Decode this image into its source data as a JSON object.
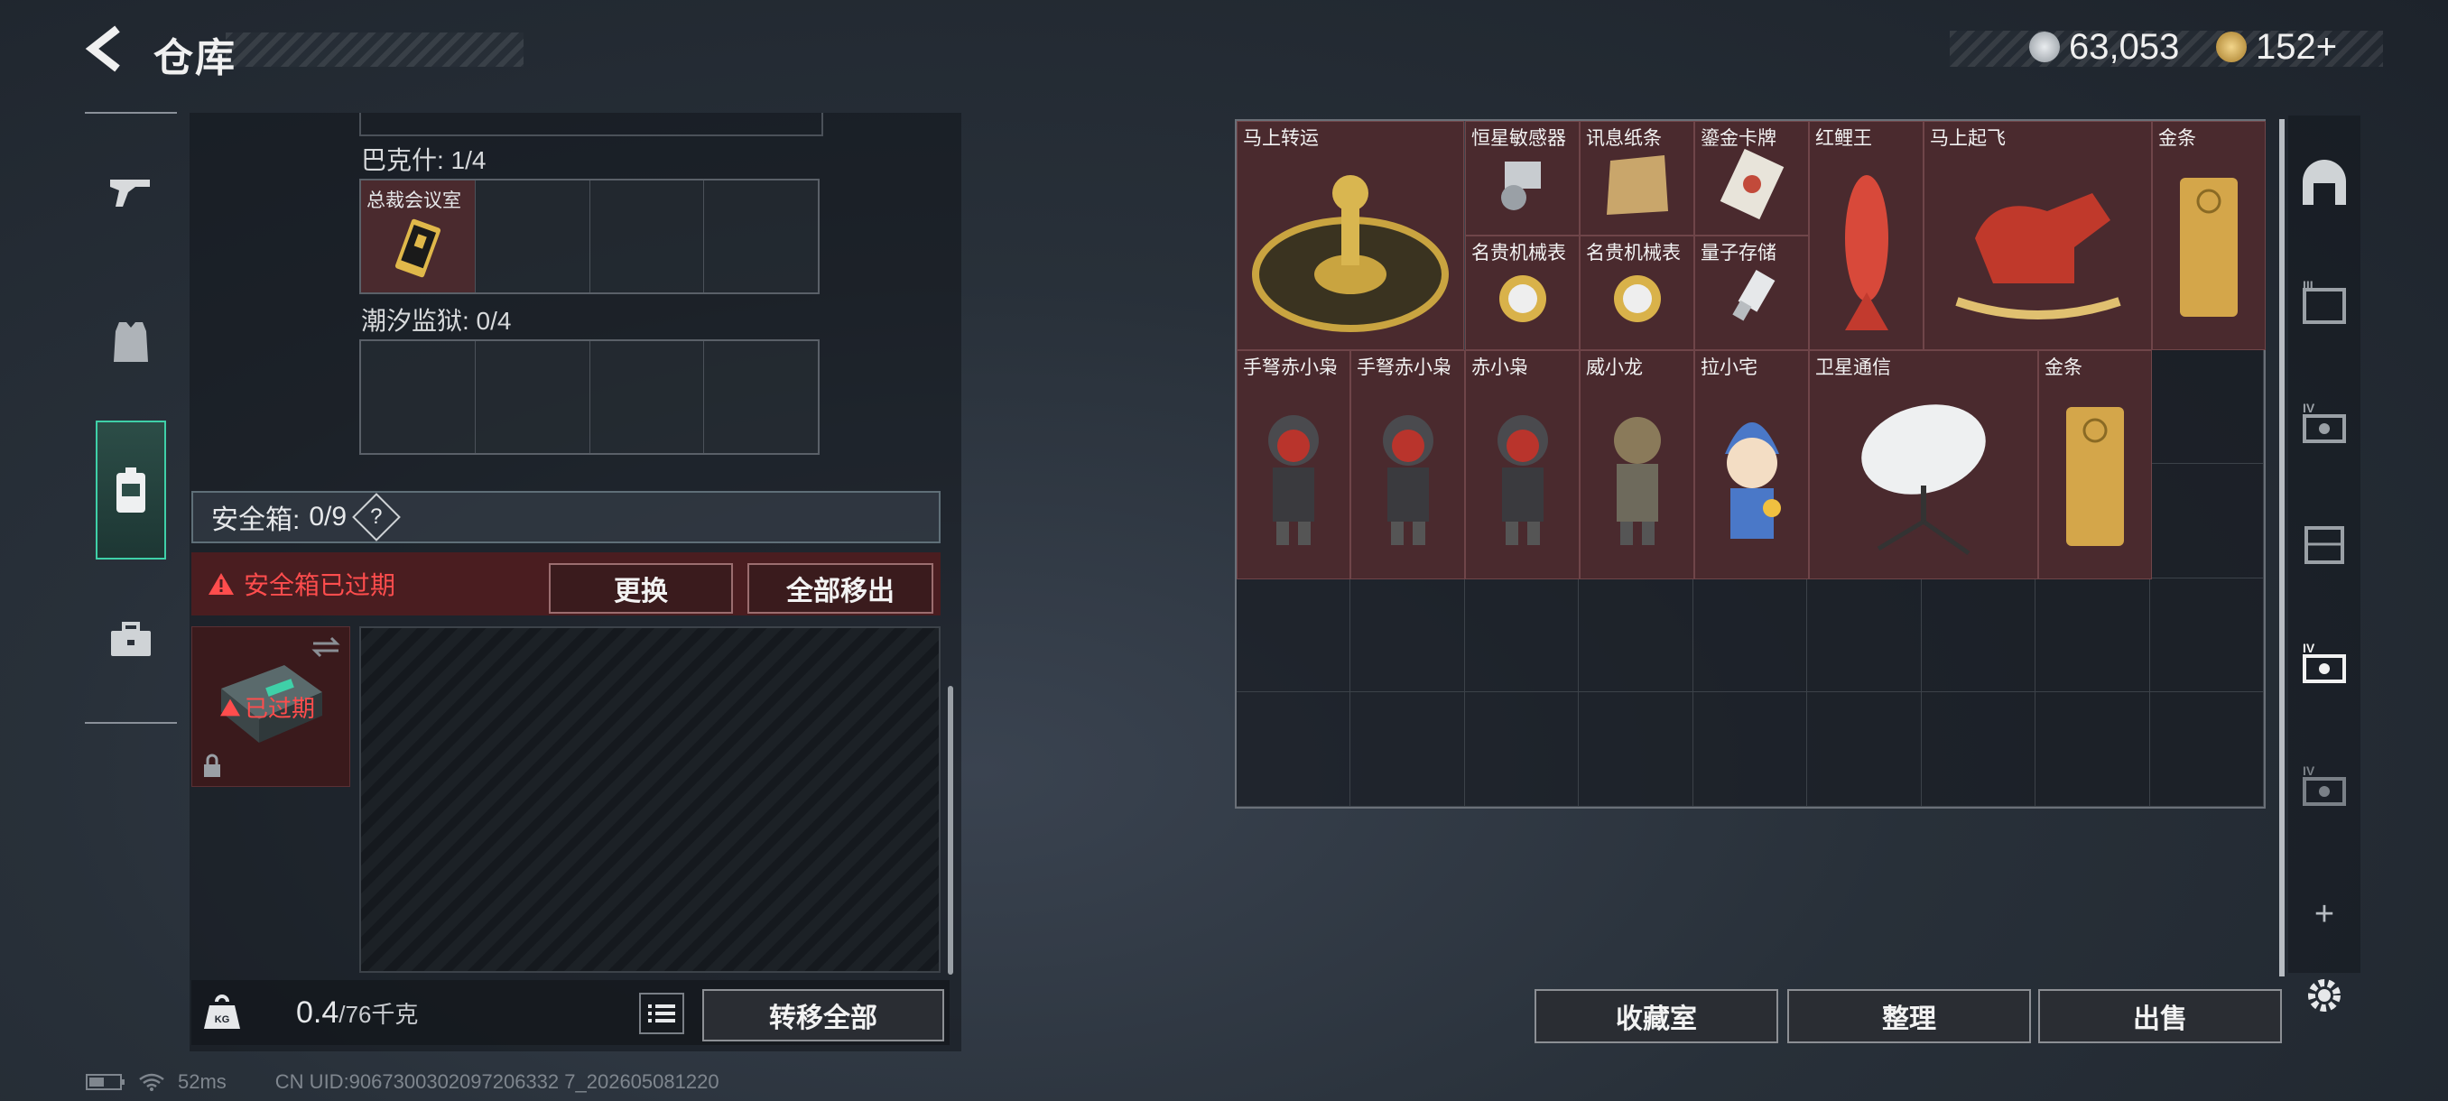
{
  "header": {
    "title": "仓库"
  },
  "currency": [
    {
      "value": "63,053",
      "icon": "silver-coin-icon",
      "color": "#c7ccd1"
    },
    {
      "value": "152+",
      "icon": "gold-coin-icon",
      "color": "#d9b45a"
    }
  ],
  "nav": [
    {
      "icon": "gun-icon"
    },
    {
      "icon": "armor-vest-icon"
    },
    {
      "icon": "backpack-icon",
      "active": true
    },
    {
      "icon": "briefcase-icon"
    }
  ],
  "containers": [
    {
      "label": "巴克什: 1/4",
      "items": [
        {
          "name": "总裁会议室",
          "icon": "keycard-icon"
        }
      ]
    },
    {
      "label": "潮汐监狱: 0/4",
      "items": []
    }
  ],
  "safebox": {
    "label": "安全箱:",
    "value": "0/9",
    "help": "?",
    "warning": "安全箱已过期",
    "replace_label": "更换",
    "remove_all_label": "全部移出",
    "expired_label": "已过期"
  },
  "weight": {
    "current": "0.4",
    "max": "/76千克",
    "transfer_all_label": "转移全部"
  },
  "stash_items": [
    {
      "name": "马上转运"
    },
    {
      "name": "恒星敏感器"
    },
    {
      "name": "讯息纸条"
    },
    {
      "name": "鎏金卡牌"
    },
    {
      "name": "红鲤王"
    },
    {
      "name": "马上起飞"
    },
    {
      "name": "金条"
    },
    {
      "name": "名贵机械表"
    },
    {
      "name": "名贵机械表"
    },
    {
      "name": "量子存储"
    },
    {
      "name": "手弩赤小枭"
    },
    {
      "name": "手弩赤小枭"
    },
    {
      "name": "赤小枭"
    },
    {
      "name": "威小龙"
    },
    {
      "name": "拉小宅"
    },
    {
      "name": "卫星通信"
    },
    {
      "name": "金条"
    }
  ],
  "actions": {
    "collection_label": "收藏室",
    "sort_label": "整理",
    "sell_label": "出售"
  },
  "side_tabs": [
    {
      "icon": "safe-room-icon"
    },
    {
      "icon": "tier3-case-icon",
      "tier": "III"
    },
    {
      "icon": "tier4-case-icon",
      "tier": "IV"
    },
    {
      "icon": "storage-rack-icon"
    },
    {
      "icon": "tier4-case-active-icon",
      "tier": "IV"
    },
    {
      "icon": "tier4-case-icon",
      "tier": "IV"
    }
  ],
  "footer": {
    "ping": "52ms",
    "uid": "CN UID:9067300302097206332 7_202605081220"
  }
}
